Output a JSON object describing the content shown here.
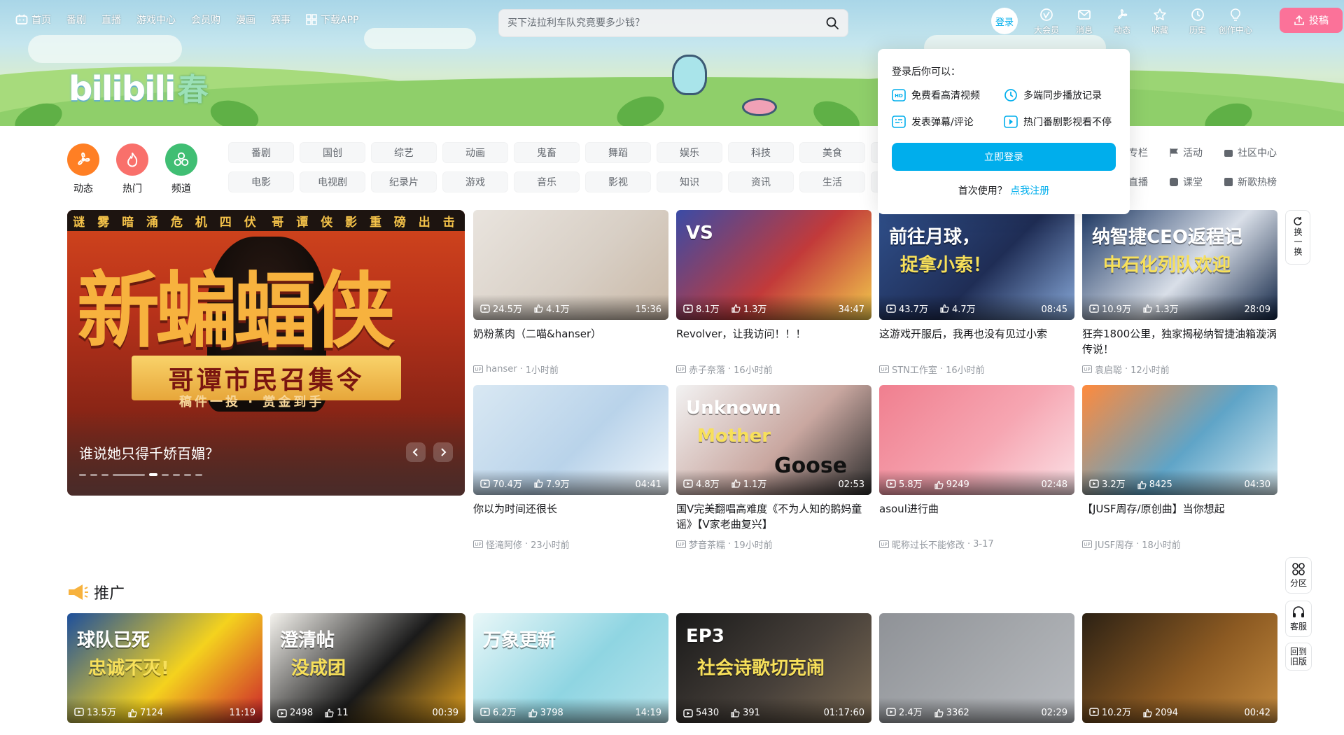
{
  "colors": {
    "brand_blue": "#00aeec",
    "brand_pink": "#fb7299",
    "text": "#18191c",
    "muted": "#9499a0"
  },
  "topnav": [
    {
      "label": "首页",
      "icon": "tv-icon"
    },
    {
      "label": "番剧"
    },
    {
      "label": "直播"
    },
    {
      "label": "游戏中心"
    },
    {
      "label": "会员购"
    },
    {
      "label": "漫画"
    },
    {
      "label": "赛事"
    },
    {
      "label": "下载APP",
      "icon": "download-app-icon"
    }
  ],
  "search": {
    "placeholder": "买下法拉利车队究竟要多少钱？"
  },
  "user": {
    "login": "登录"
  },
  "rightnav": [
    {
      "label": "大会员",
      "icon": "vip-icon"
    },
    {
      "label": "消息",
      "icon": "message-icon"
    },
    {
      "label": "动态",
      "icon": "dynamic-icon"
    },
    {
      "label": "收藏",
      "icon": "star-icon"
    },
    {
      "label": "历史",
      "icon": "clock-icon"
    },
    {
      "label": "创作中心",
      "icon": "bulb-icon"
    }
  ],
  "upload": "投稿",
  "logo": {
    "text": "bilibili",
    "season": "春"
  },
  "channel_icons": [
    {
      "label": "动态",
      "color": "#ff7f24"
    },
    {
      "label": "热门",
      "color": "#f9706b"
    },
    {
      "label": "频道",
      "color": "#40be73"
    }
  ],
  "channels_row1": [
    "番剧",
    "国创",
    "综艺",
    "动画",
    "鬼畜",
    "舞蹈",
    "娱乐",
    "科技",
    "美食",
    ""
  ],
  "channels_row2": [
    "电影",
    "电视剧",
    "纪录片",
    "游戏",
    "音乐",
    "影视",
    "知识",
    "资讯",
    "生活",
    ""
  ],
  "channel_links": [
    {
      "label": "专栏",
      "icon": "column-icon"
    },
    {
      "label": "活动",
      "icon": "flag-icon"
    },
    {
      "label": "社区中心",
      "icon": "community-icon"
    },
    {
      "label": "直播",
      "icon": "live-icon"
    },
    {
      "label": "课堂",
      "icon": "class-icon"
    },
    {
      "label": "新歌热榜",
      "icon": "music-chart-icon"
    }
  ],
  "carousel": {
    "topline_left": "谜 雾 暗 涌 危 机 四 伏",
    "topline_right": "哥 谭 侠 影 重 磅 出 击",
    "big": "新蝙蝠侠",
    "slogan": "哥谭市民召集令",
    "sub": "稿件一投 · 赏金到手",
    "title": "谁说她只得千娇百媚？",
    "dots": 9,
    "active_dot": 4
  },
  "refresh": {
    "label": "换一换"
  },
  "videos": [
    {
      "title": "奶粉蒸肉（二喵&hanser）",
      "author": "hanser",
      "time": "1小时前",
      "views": "24.5万",
      "likes": "4.1万",
      "duration": "15:36"
    },
    {
      "title": "Revolver，让我访问！！！",
      "author": "赤子奈落",
      "time": "16小时前",
      "views": "8.1万",
      "likes": "1.3万",
      "duration": "34:47",
      "overlay": "VS"
    },
    {
      "title": "这游戏开服后，我再也没有见过小索",
      "author": "STN工作室",
      "time": "16小时前",
      "views": "43.7万",
      "likes": "4.7万",
      "duration": "08:45",
      "overlay": "前往月球，",
      "overlay2": "捉拿小索！"
    },
    {
      "title": "狂奔1800公里，独家揭秘纳智捷油箱漩涡传说！",
      "author": "袁启聪",
      "time": "12小时前",
      "views": "10.9万",
      "likes": "1.3万",
      "duration": "28:09",
      "overlay": "纳智捷CEO返程记",
      "overlay2": "中石化列队欢迎"
    },
    {
      "title": "你以为时间还很长",
      "author": "怪滝阿修",
      "time": "23小时前",
      "views": "70.4万",
      "likes": "7.9万",
      "duration": "04:41"
    },
    {
      "title": "国V完美翻唱高难度《不为人知的鹅妈童谣》【V家老曲复兴】",
      "author": "梦音茶糯",
      "time": "19小时前",
      "views": "4.8万",
      "likes": "1.1万",
      "duration": "02:53",
      "overlay": "Unknown",
      "overlay2": "Mother",
      "overlay3": "Goose"
    },
    {
      "title": "asoul进行曲",
      "author": "昵称过长不能修改",
      "time": "3-17",
      "views": "5.8万",
      "likes": "9249",
      "duration": "02:48"
    },
    {
      "title": "【JUSF周存/原创曲】当你想起",
      "author": "JUSF周存",
      "time": "18小时前",
      "views": "3.2万",
      "likes": "8425",
      "duration": "04:30"
    }
  ],
  "promo": {
    "heading": "推广"
  },
  "promo_videos": [
    {
      "views": "13.5万",
      "likes": "7124",
      "duration": "11:19",
      "overlay": "球队已死",
      "overlay2": "忠诚不灭!"
    },
    {
      "views": "2498",
      "likes": "11",
      "duration": "00:39",
      "overlay": "澄清帖",
      "overlay2": "没成团"
    },
    {
      "views": "6.2万",
      "likes": "3798",
      "duration": "14:19",
      "overlay": "万象更新"
    },
    {
      "views": "5430",
      "likes": "391",
      "duration": "01:17:60",
      "overlay": "EP3",
      "overlay2": "社会诗歌切克闹"
    },
    {
      "views": "2.4万",
      "likes": "3362",
      "duration": "02:29"
    },
    {
      "views": "10.2万",
      "likes": "2094",
      "duration": "00:42"
    }
  ],
  "popup": {
    "heading": "登录后你可以：",
    "features": [
      {
        "label": "免费看高清视频",
        "icon": "hd-icon"
      },
      {
        "label": "多端同步播放记录",
        "icon": "clock-icon"
      },
      {
        "label": "发表弹幕/评论",
        "icon": "danmaku-icon"
      },
      {
        "label": "热门番剧影视看不停",
        "icon": "play-icon"
      }
    ],
    "login_button": "立即登录",
    "footer_text": "首次使用？",
    "register_link": "点我注册"
  },
  "side_tools": [
    {
      "label": "分区",
      "icon": "grid-icon"
    },
    {
      "label": "客服",
      "icon": "headset-icon"
    },
    {
      "label": "回到旧版"
    }
  ]
}
